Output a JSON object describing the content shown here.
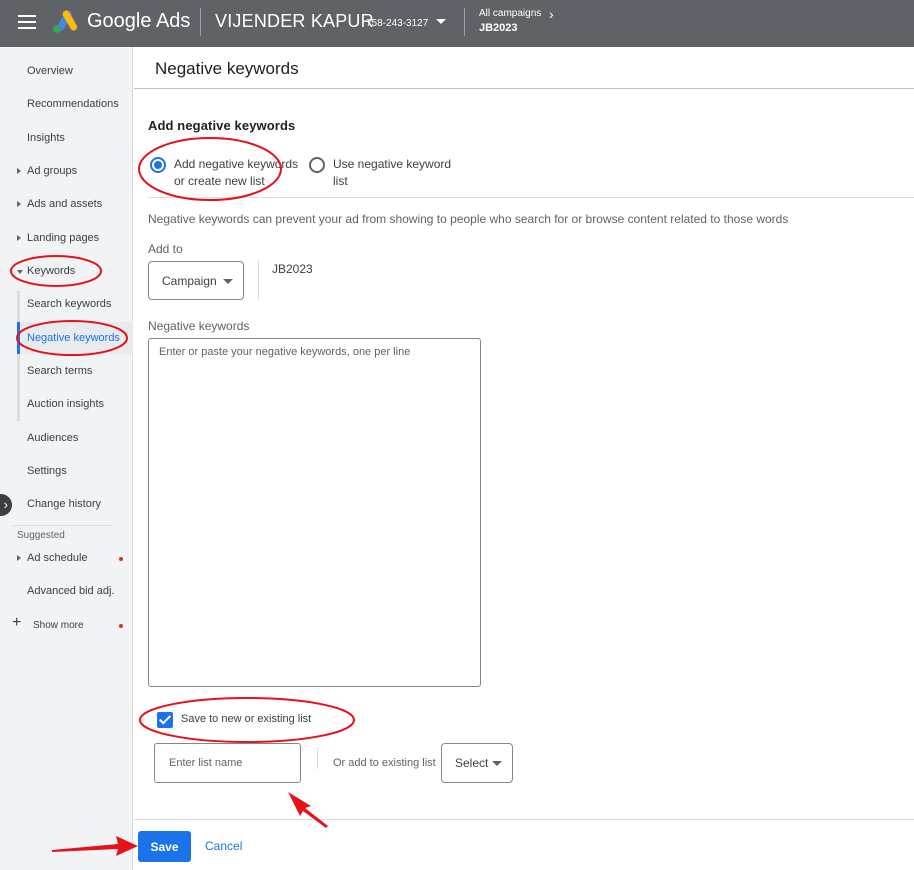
{
  "header": {
    "brand": "Google Ads",
    "account_name": "VIJENDER KAPUR",
    "account_id": "758-243-3127",
    "campaign_scope": "All campaigns",
    "campaign_name": "JB2023"
  },
  "sidebar": {
    "items": [
      {
        "label": "Overview"
      },
      {
        "label": "Recommendations"
      },
      {
        "label": "Insights"
      },
      {
        "label": "Ad groups"
      },
      {
        "label": "Ads and assets"
      },
      {
        "label": "Landing pages"
      },
      {
        "label": "Keywords"
      },
      {
        "label": "Search keywords"
      },
      {
        "label": "Negative keywords",
        "active": true
      },
      {
        "label": "Search terms"
      },
      {
        "label": "Auction insights"
      },
      {
        "label": "Audiences"
      },
      {
        "label": "Settings"
      },
      {
        "label": "Change history"
      }
    ],
    "suggested_heading": "Suggested",
    "suggested_items": [
      {
        "label": "Ad schedule"
      },
      {
        "label": "Advanced bid adj."
      }
    ],
    "show_more": "Show more"
  },
  "main": {
    "page_title": "Negative keywords",
    "section_title": "Add negative keywords",
    "radio_add_new": "Add negative keywords or create new list",
    "radio_use_list": "Use negative keyword list",
    "description": "Negative keywords can prevent your ad from showing to people who search for or browse content related to those words",
    "add_to_label": "Add to",
    "add_to_select": "Campaign",
    "add_to_value": "JB2023",
    "keywords_label": "Negative keywords",
    "keywords_placeholder": "Enter or paste your negative keywords, one per line",
    "save_list_checkbox": "Save to new or existing list",
    "list_name_placeholder": "Enter list name",
    "or_existing_label": "Or add to existing list",
    "existing_select": "Select"
  },
  "footer": {
    "save": "Save",
    "cancel": "Cancel"
  },
  "colors": {
    "topbar": "#5f6368",
    "accent": "#1a73e8",
    "annotation": "#e5121b"
  }
}
